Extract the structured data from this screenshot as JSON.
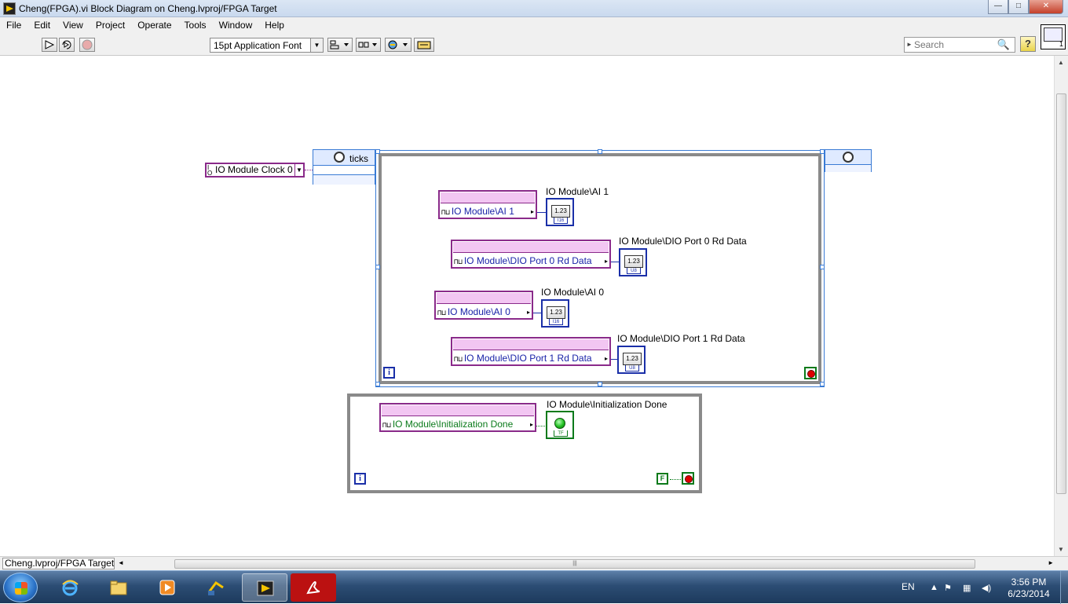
{
  "window": {
    "title": "Cheng(FPGA).vi Block Diagram on Cheng.lvproj/FPGA Target",
    "minimize": "—",
    "maximize": "□",
    "close": "✕"
  },
  "menu": [
    "File",
    "Edit",
    "View",
    "Project",
    "Operate",
    "Tools",
    "Window",
    "Help"
  ],
  "toolbar": {
    "font": "15pt Application Font",
    "search_placeholder": "Search",
    "help": "?",
    "icon_number": "1"
  },
  "diagram": {
    "clock_constant": "IO Module Clock 0",
    "timed_loop_label": "ticks",
    "main_loop": {
      "items": [
        {
          "node": "IO Module\\AI 1",
          "indicator_label": "IO Module\\AI 1",
          "display": "1.23",
          "type": "I16"
        },
        {
          "node": "IO Module\\DIO Port 0 Rd Data",
          "indicator_label": "IO Module\\DIO Port 0 Rd Data",
          "display": "1.23",
          "type": "U8"
        },
        {
          "node": "IO Module\\AI 0",
          "indicator_label": "IO Module\\AI 0",
          "display": "1.23",
          "type": "I16"
        },
        {
          "node": "IO Module\\DIO Port 1 Rd Data",
          "indicator_label": "IO Module\\DIO Port 1 Rd Data",
          "display": "1.23",
          "type": "U8"
        }
      ],
      "iteration": "i"
    },
    "init_loop": {
      "node": "IO Module\\Initialization Done",
      "indicator_label": "IO Module\\Initialization Done",
      "type": "TF",
      "iteration": "i",
      "bool_constant": "F"
    }
  },
  "status": {
    "context": "Cheng.lvproj/FPGA Target"
  },
  "taskbar": {
    "lang": "EN",
    "time": "3:56 PM",
    "date": "6/23/2014"
  },
  "colors": {
    "fpga_io": "#8a2a8a",
    "numeric_indicator": "#1a2fa8",
    "boolean": "#0a7a1a",
    "loop_border": "#8a8a8a"
  }
}
